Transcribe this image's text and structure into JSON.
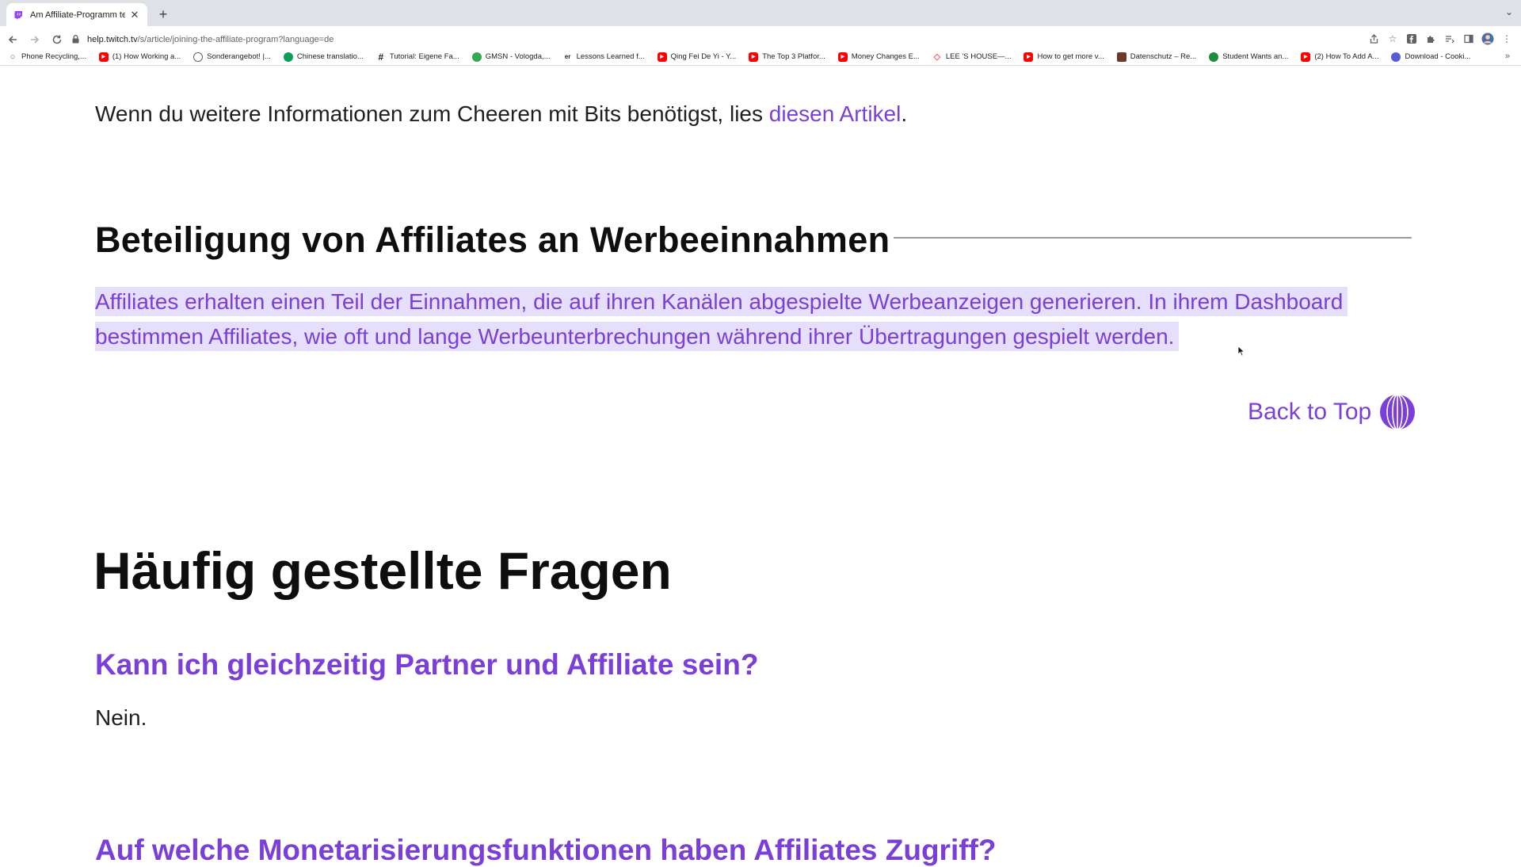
{
  "browser": {
    "tab_title": "Am Affiliate-Programm teilneh",
    "url_host": "help.twitch.tv",
    "url_path": "/s/article/joining-the-affiliate-program?language=de",
    "bookmarks": [
      {
        "label": "Phone Recycling,...",
        "icon": "search-icon",
        "color": "#5f6368"
      },
      {
        "label": "(1) How Working a...",
        "icon": "youtube-icon",
        "color": "#ff0000"
      },
      {
        "label": "Sonderangebot! |...",
        "icon": "circle-icon",
        "color": "#5f6368"
      },
      {
        "label": "Chinese translatio...",
        "icon": "green-circle-icon",
        "color": "#0f9d58"
      },
      {
        "label": "Tutorial: Eigene Fa...",
        "icon": "hash-icon",
        "color": "#202124"
      },
      {
        "label": "GMSN - Vologda,...",
        "icon": "green-badge-icon",
        "color": "#34a853"
      },
      {
        "label": "Lessons Learned f...",
        "icon": "er-icon",
        "color": "#202124"
      },
      {
        "label": "Qing Fei De Yi - Y...",
        "icon": "youtube-icon",
        "color": "#ff0000"
      },
      {
        "label": "The Top 3 Platfor...",
        "icon": "youtube-icon",
        "color": "#ff0000"
      },
      {
        "label": "Money Changes E...",
        "icon": "youtube-icon",
        "color": "#ff0000"
      },
      {
        "label": "LEE 'S HOUSE—...",
        "icon": "airbnb-icon",
        "color": "#ff5a5f"
      },
      {
        "label": "How to get more v...",
        "icon": "youtube-icon",
        "color": "#ff0000"
      },
      {
        "label": "Datenschutz – Re...",
        "icon": "dark-square-icon",
        "color": "#6b3a2a"
      },
      {
        "label": "Student Wants an...",
        "icon": "green-circle-icon",
        "color": "#1e8e3e"
      },
      {
        "label": "(2) How To Add A...",
        "icon": "youtube-icon",
        "color": "#ff0000"
      },
      {
        "label": "Download - Cooki...",
        "icon": "cookie-icon",
        "color": "#5b5bd6"
      }
    ]
  },
  "article": {
    "bits_text": "Wenn du weitere Informationen zum Cheeren mit Bits benötigst, lies ",
    "bits_link": "diesen Artikel",
    "bits_end": ".",
    "section_heading": "Beteiligung von Affiliates an Werbeeinnahmen",
    "highlight_line1": "Affiliates erhalten einen Teil der Einnahmen, die auf ihren Kanälen abgespielte Werbeanzeigen generieren. In ihrem Dashboard",
    "highlight_line2": "bestimmen Affiliates, wie oft und lange Werbeunterbrechungen während ihrer Übertragungen gespielt werden.",
    "back_to_top": "Back to Top"
  },
  "faq": {
    "title": "Häufig gestellte Fragen",
    "q1": "Kann ich gleichzeitig Partner und Affiliate sein?",
    "a1": "Nein.",
    "q2": "Auf welche Monetarisierungsfunktionen haben Affiliates Zugriff?"
  },
  "colors": {
    "accent": "#7a3fd9",
    "highlight": "#e6dffb"
  }
}
